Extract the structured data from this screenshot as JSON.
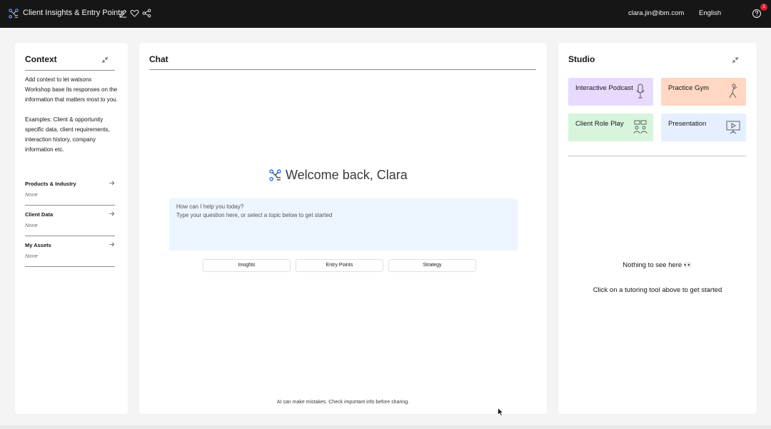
{
  "header": {
    "title": "Client Insights & Entry Points",
    "email": "clara.jin@ibm.com",
    "language": "English",
    "notification_count": "1"
  },
  "context": {
    "title": "Context",
    "description": "Add context to let watsonx Workshop base its responses on the information that matters most to you.",
    "examples": "Examples: Client & opportunity specific data, client requirements, interaction history, company information etc.",
    "sections": [
      {
        "label": "Products & Industry",
        "value": "None"
      },
      {
        "label": "Client Data",
        "value": "None"
      },
      {
        "label": "My Assets",
        "value": "None"
      }
    ]
  },
  "chat": {
    "title": "Chat",
    "welcome": "Welcome back, Clara",
    "prompt_line1": "How can I help you today?",
    "prompt_line2": "Type your question here, or select a topic below to get started",
    "topics": [
      "Insights",
      "Entry Points",
      "Strategy"
    ],
    "disclaimer": "AI can make mistakes. Check important info before sharing."
  },
  "studio": {
    "title": "Studio",
    "tools": [
      {
        "label": "Interactive Podcast",
        "color": "#e8daff"
      },
      {
        "label": "Practice Gym",
        "color": "#ffd7c2"
      },
      {
        "label": "Client Role Play",
        "color": "#d6f5dc"
      },
      {
        "label": "Presentation",
        "color": "#e5efff"
      }
    ],
    "empty_title": "Nothing to see here 👀",
    "empty_subtitle": "Click on a tutoring tool above to get started"
  },
  "colors": {
    "topbar": "#161616",
    "accent": "#0f62fe",
    "chat_box": "#edf5ff"
  }
}
